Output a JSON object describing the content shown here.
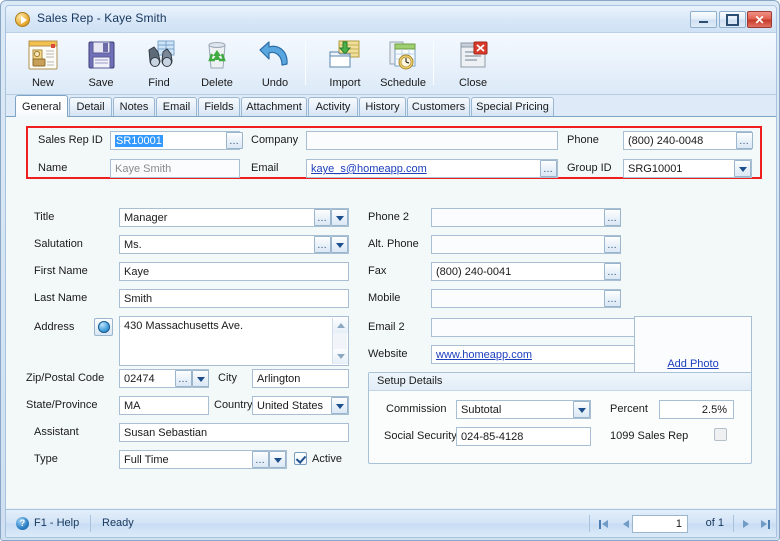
{
  "window": {
    "title": "Sales Rep - Kaye Smith",
    "icon": "play-circle-icon",
    "minimize_label": "Minimize",
    "maximize_label": "Maximize",
    "close_label": "✕",
    "accent_red": "#ef1f1f",
    "link_color": "#1c3fbe",
    "selection_color": "#3399ff"
  },
  "toolbar": {
    "buttons": [
      {
        "label": "New",
        "icon": "new-record-icon"
      },
      {
        "label": "Save",
        "icon": "floppy-disk-icon"
      },
      {
        "label": "Find",
        "icon": "binoculars-icon"
      },
      {
        "label": "Delete",
        "icon": "recycle-bin-icon"
      },
      {
        "label": "Undo",
        "icon": "undo-arrow-icon"
      },
      {
        "label": "Import",
        "icon": "import-folder-icon"
      },
      {
        "label": "Schedule",
        "icon": "schedule-clock-icon"
      },
      {
        "label": "Close",
        "icon": "close-document-icon"
      }
    ]
  },
  "tabs": [
    {
      "label": "General",
      "active": true
    },
    {
      "label": "Detail",
      "active": false
    },
    {
      "label": "Notes",
      "active": false
    },
    {
      "label": "Email",
      "active": false
    },
    {
      "label": "Fields",
      "active": false
    },
    {
      "label": "Attachment",
      "active": false
    },
    {
      "label": "Activity",
      "active": false
    },
    {
      "label": "History",
      "active": false
    },
    {
      "label": "Customers",
      "active": false
    },
    {
      "label": "Special Pricing",
      "active": false
    }
  ],
  "key_section": {
    "sales_rep_id_label": "Sales Rep ID",
    "sales_rep_id_value": "SR10001",
    "company_label": "Company",
    "company_value": "",
    "phone_label": "Phone",
    "phone_value": "(800) 240-0048",
    "name_label": "Name",
    "name_value": "Kaye Smith",
    "email_label": "Email",
    "email_value": "kaye_s@homeapp.com",
    "group_id_label": "Group ID",
    "group_id_value": "SRG10001"
  },
  "left_form": {
    "title_label": "Title",
    "title_value": "Manager",
    "salutation_label": "Salutation",
    "salutation_value": "Ms.",
    "first_name_label": "First Name",
    "first_name_value": "Kaye",
    "last_name_label": "Last Name",
    "last_name_value": "Smith",
    "address_label": "Address",
    "address_value": "430 Massachusetts Ave.",
    "zip_label": "Zip/Postal Code",
    "zip_value": "02474",
    "city_label": "City",
    "city_value": "Arlington",
    "state_label": "State/Province",
    "state_value": "MA",
    "country_label": "Country",
    "country_value": "United States",
    "assistant_label": "Assistant",
    "assistant_value": "Susan Sebastian",
    "type_label": "Type",
    "type_value": "Full Time",
    "active_label": "Active",
    "active_checked": true
  },
  "right_form": {
    "phone2_label": "Phone 2",
    "phone2_value": "",
    "alt_phone_label": "Alt. Phone",
    "alt_phone_value": "",
    "fax_label": "Fax",
    "fax_value": "(800) 240-0041",
    "mobile_label": "Mobile",
    "mobile_value": "",
    "email2_label": "Email 2",
    "email2_value": "",
    "website_label": "Website",
    "website_value": "www.homeapp.com",
    "photo_link": "Add Photo"
  },
  "setup_details": {
    "title": "Setup Details",
    "commission_label": "Commission",
    "commission_value": "Subtotal",
    "percent_label": "Percent",
    "percent_value": "2.5%",
    "social_security_label": "Social Security",
    "social_security_value": "024-85-4128",
    "sales_rep_1099_label": "1099 Sales Rep",
    "sales_rep_1099_checked": false
  },
  "statusbar": {
    "help_icon": "question-mark-icon",
    "help_text": "F1 - Help",
    "status_text": "Ready",
    "page_value": "1",
    "of_text": "of 1",
    "first_label": "First record",
    "prev_label": "Previous record",
    "next_label": "Next record",
    "last_label": "Last record"
  }
}
